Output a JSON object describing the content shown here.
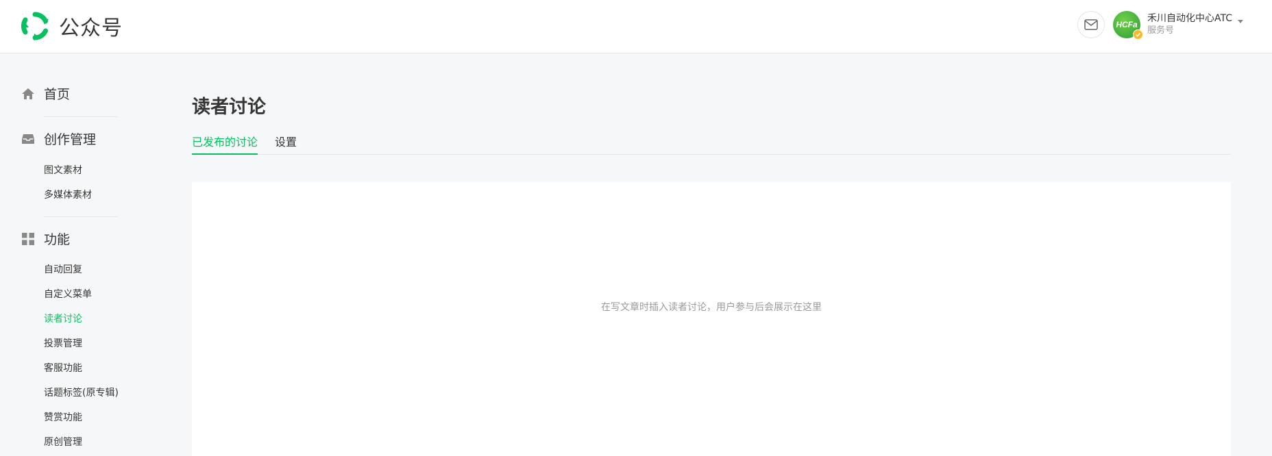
{
  "header": {
    "brand_name": "公众号",
    "account": {
      "name": "禾川自动化中心ATC",
      "type": "服务号",
      "avatar_text": "HCFa"
    },
    "icons": {
      "message": "mail-icon",
      "dropdown": "chevron-down-icon",
      "verified": "verified-badge-icon"
    }
  },
  "sidebar": {
    "home": {
      "label": "首页",
      "icon": "home-icon"
    },
    "creation": {
      "label": "创作管理",
      "icon": "inbox-icon",
      "items": [
        "图文素材",
        "多媒体素材"
      ]
    },
    "features": {
      "label": "功能",
      "icon": "grid-icon",
      "items": [
        "自动回复",
        "自定义菜单",
        "读者讨论",
        "投票管理",
        "客服功能",
        "话题标签(原专辑)",
        "赞赏功能",
        "原创管理"
      ],
      "active_item": "读者讨论"
    }
  },
  "main": {
    "title": "读者讨论",
    "tabs": [
      {
        "label": "已发布的讨论",
        "active": true
      },
      {
        "label": "设置",
        "active": false
      }
    ],
    "empty_message": "在写文章时插入读者讨论，用户参与后会展示在这里"
  },
  "colors": {
    "accent": "#07c160",
    "background": "#f6f7f8",
    "text": "#353535",
    "muted": "#9a9a9a"
  }
}
